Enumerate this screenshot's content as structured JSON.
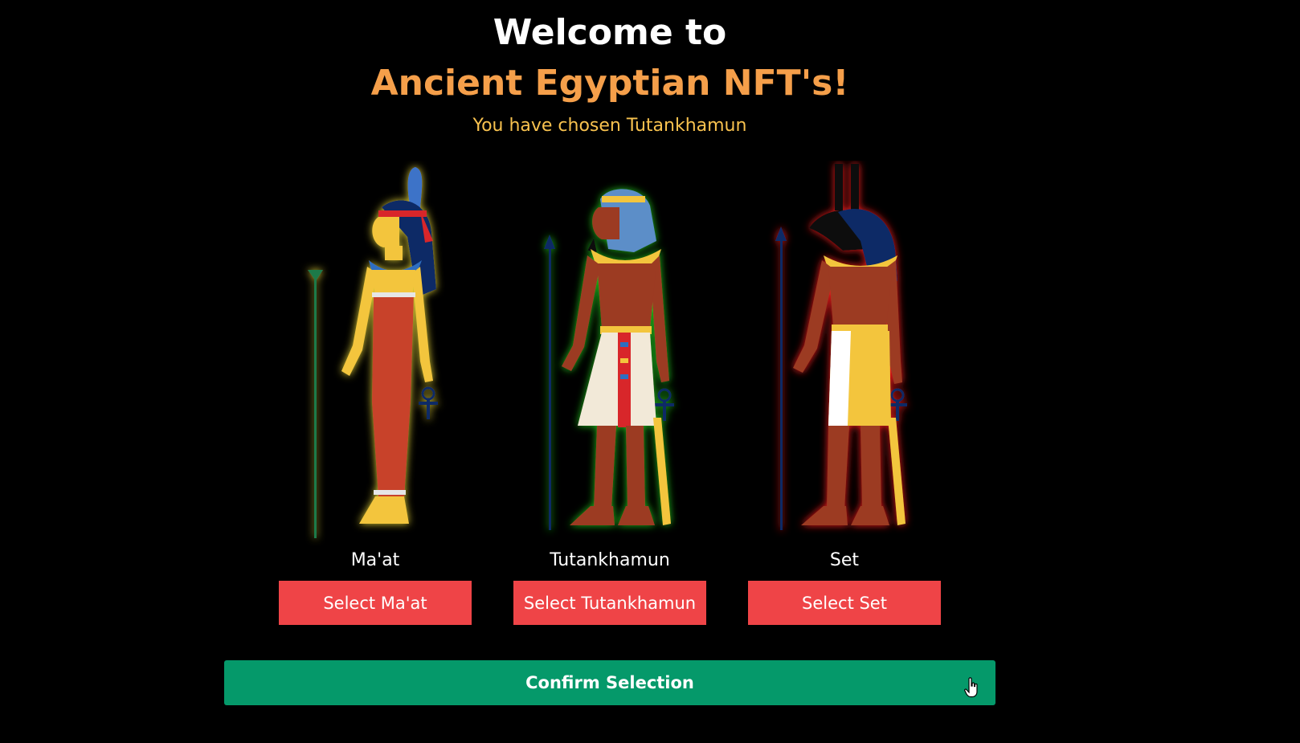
{
  "header": {
    "welcome": "Welcome to",
    "brand": "Ancient Egyptian NFT's!",
    "chosen_text": "You have chosen Tutankhamun"
  },
  "cards": [
    {
      "name": "Ma'at",
      "button_label": "Select Ma'at",
      "glow_color": "#f5e33a",
      "figure_icon": "maat-figure-icon"
    },
    {
      "name": "Tutankhamun",
      "button_label": "Select Tutankhamun",
      "glow_color": "#24d31e",
      "figure_icon": "tutankhamun-figure-icon"
    },
    {
      "name": "Set",
      "button_label": "Select Set",
      "glow_color": "#ff1d1d",
      "figure_icon": "set-figure-icon"
    }
  ],
  "confirm": {
    "label": "Confirm Selection"
  },
  "colors": {
    "background": "#000000",
    "brand": "#f59f4a",
    "chosen": "#f8c24f",
    "select_button": "#ef4447",
    "confirm_button": "#05996a"
  }
}
